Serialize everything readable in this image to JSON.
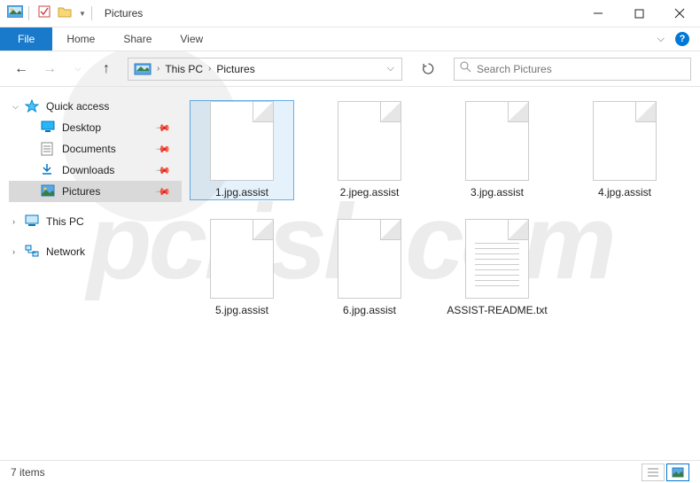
{
  "window": {
    "title": "Pictures"
  },
  "ribbon": {
    "file": "File",
    "tabs": [
      "Home",
      "Share",
      "View"
    ]
  },
  "breadcrumb": {
    "segments": [
      "This PC",
      "Pictures"
    ]
  },
  "search": {
    "placeholder": "Search Pictures"
  },
  "sidebar": {
    "quick_access": "Quick access",
    "quick_items": [
      {
        "label": "Desktop",
        "icon": "desktop"
      },
      {
        "label": "Documents",
        "icon": "documents"
      },
      {
        "label": "Downloads",
        "icon": "downloads"
      },
      {
        "label": "Pictures",
        "icon": "pictures",
        "selected": true
      }
    ],
    "this_pc": "This PC",
    "network": "Network"
  },
  "files": [
    {
      "name": "1.jpg.assist",
      "type": "blank",
      "selected": true
    },
    {
      "name": "2.jpeg.assist",
      "type": "blank"
    },
    {
      "name": "3.jpg.assist",
      "type": "blank"
    },
    {
      "name": "4.jpg.assist",
      "type": "blank"
    },
    {
      "name": "5.jpg.assist",
      "type": "blank"
    },
    {
      "name": "6.jpg.assist",
      "type": "blank"
    },
    {
      "name": "ASSIST-README.txt",
      "type": "text"
    }
  ],
  "status": {
    "count_label": "7 items"
  },
  "watermark": "pcrisk.com"
}
